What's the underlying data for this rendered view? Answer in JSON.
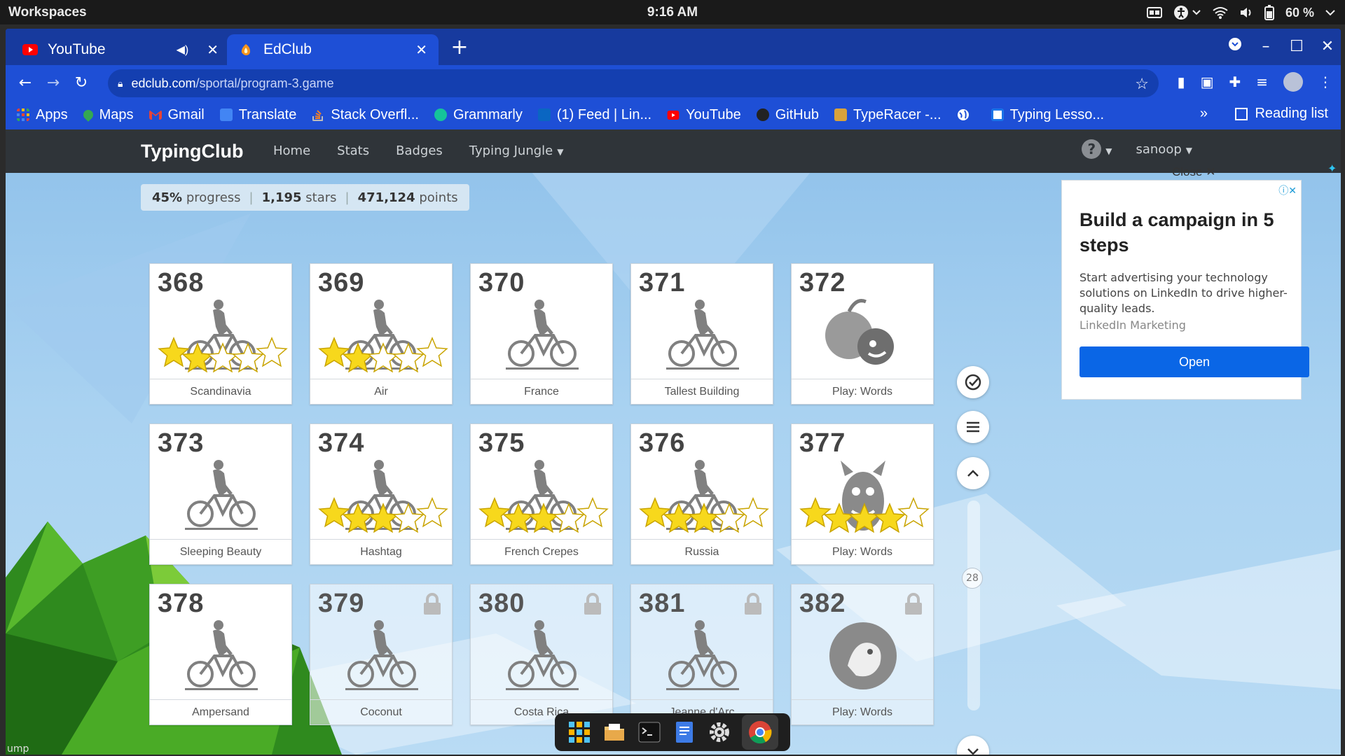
{
  "os": {
    "workspaces": "Workspaces",
    "clock": "9:16 AM",
    "battery": "60 %"
  },
  "browser": {
    "tabs": [
      {
        "title": "YouTube",
        "active": false
      },
      {
        "title": "EdClub",
        "active": true
      }
    ],
    "url_host": "edclub.com",
    "url_path": "/sportal/program-3.game",
    "bookmarks": [
      {
        "label": "Apps",
        "color": "#e94235"
      },
      {
        "label": "Maps",
        "color": "#34a853"
      },
      {
        "label": "Gmail",
        "color": "#ea4335"
      },
      {
        "label": "Translate",
        "color": "#4285f4"
      },
      {
        "label": "Stack Overfl...",
        "color": "#f48024"
      },
      {
        "label": "Grammarly",
        "color": "#15c39a"
      },
      {
        "label": "(1) Feed | Lin...",
        "color": "#0a66c2"
      },
      {
        "label": "YouTube",
        "color": "#ff0000"
      },
      {
        "label": "GitHub",
        "color": "#222222"
      },
      {
        "label": "TypeRacer -...",
        "color": "#d9a23b"
      },
      {
        "label": "",
        "color": "#ffffff"
      },
      {
        "label": "Typing Lesso...",
        "color": "#1a73e8"
      }
    ],
    "bookmarks_more": "»",
    "reading_list": "Reading list"
  },
  "site": {
    "brand": "TypingClub",
    "nav": [
      "Home",
      "Stats",
      "Badges",
      "Typing Jungle"
    ],
    "help": "?",
    "user": "sanoop"
  },
  "progress": {
    "percent": "45%",
    "percent_label": "progress",
    "stars": "1,195",
    "stars_label": "stars",
    "points": "471,124",
    "points_label": "points"
  },
  "lessons": [
    {
      "num": "368",
      "label": "Scandinavia",
      "icon": "bike",
      "stars": 2,
      "locked": false
    },
    {
      "num": "369",
      "label": "Air",
      "icon": "bike",
      "stars": 2,
      "locked": false
    },
    {
      "num": "370",
      "label": "France",
      "icon": "bike",
      "stars": 0,
      "locked": false
    },
    {
      "num": "371",
      "label": "Tallest Building",
      "icon": "bike",
      "stars": 0,
      "locked": false
    },
    {
      "num": "372",
      "label": "Play: Words",
      "icon": "game-apple",
      "stars": 0,
      "locked": false
    },
    {
      "num": "373",
      "label": "Sleeping Beauty",
      "icon": "bike",
      "stars": 0,
      "locked": false
    },
    {
      "num": "374",
      "label": "Hashtag",
      "icon": "bike",
      "stars": 3,
      "locked": false
    },
    {
      "num": "375",
      "label": "French Crepes",
      "icon": "bike",
      "stars": 3,
      "locked": false
    },
    {
      "num": "376",
      "label": "Russia",
      "icon": "bike",
      "stars": 3,
      "locked": false
    },
    {
      "num": "377",
      "label": "Play: Words",
      "icon": "game-monster",
      "stars": 4,
      "locked": false
    },
    {
      "num": "378",
      "label": "Ampersand",
      "icon": "bike",
      "stars": 0,
      "locked": false
    },
    {
      "num": "379",
      "label": "Coconut",
      "icon": "bike",
      "stars": 0,
      "locked": true
    },
    {
      "num": "380",
      "label": "Costa Rica",
      "icon": "bike",
      "stars": 0,
      "locked": true
    },
    {
      "num": "381",
      "label": "Jeanne d'Arc",
      "icon": "bike",
      "stars": 0,
      "locked": true
    },
    {
      "num": "382",
      "label": "Play: Words",
      "icon": "game-bird",
      "stars": 0,
      "locked": true
    }
  ],
  "side": {
    "scroll_number": "28"
  },
  "ad": {
    "close": "Close",
    "title": "Build a campaign in 5 steps",
    "body": "Start advertising your technology solutions on LinkedIn to drive higher-quality leads.",
    "source": "LinkedIn Marketing",
    "cta": "Open"
  },
  "statusbar": {
    "hint": "ump"
  },
  "colors": {
    "star": "#f7d81c",
    "star_empty": "#ffffff",
    "brand_blue": "#1e4fd6",
    "nav_dark": "#2f3439"
  }
}
